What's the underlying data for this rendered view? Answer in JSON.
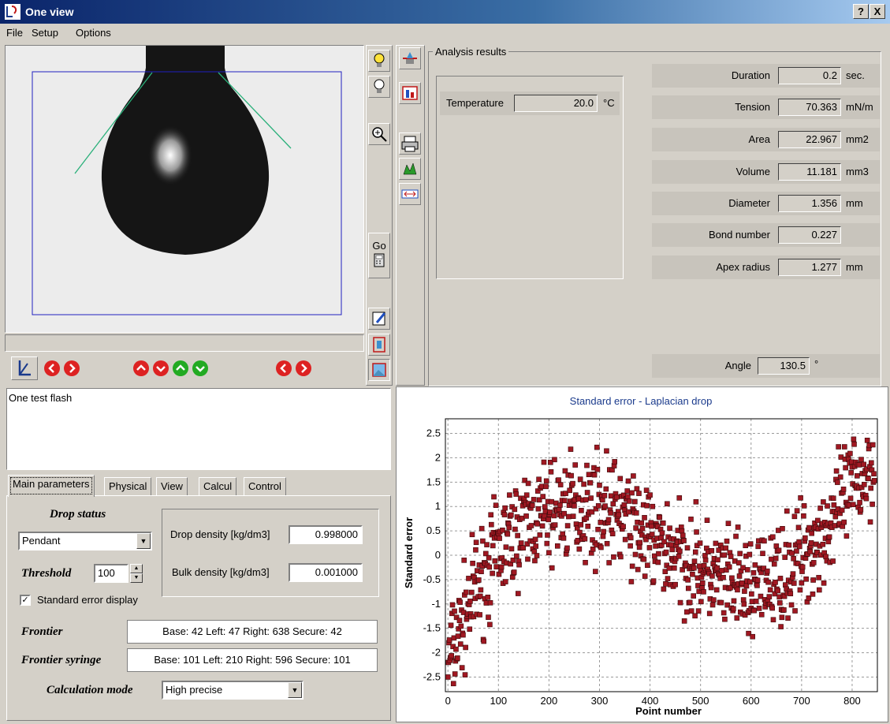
{
  "window": {
    "title": "One view",
    "help_label": "?",
    "close_label": "X"
  },
  "menu": [
    "File",
    "Setup",
    "Options"
  ],
  "analysis": {
    "group_title": "Analysis results",
    "temperature": {
      "label": "Temperature",
      "value": "20.0",
      "unit": "°C"
    },
    "results": [
      {
        "label": "Duration",
        "value": "0.2",
        "unit": "sec."
      },
      {
        "label": "Tension",
        "value": "70.363",
        "unit": "mN/m"
      },
      {
        "label": "Area",
        "value": "22.967",
        "unit": "mm2"
      },
      {
        "label": "Volume",
        "value": "11.181",
        "unit": "mm3"
      },
      {
        "label": "Diameter",
        "value": "1.356",
        "unit": "mm"
      },
      {
        "label": "Bond number",
        "value": "0.227",
        "unit": ""
      },
      {
        "label": "Apex radius",
        "value": "1.277",
        "unit": "mm"
      }
    ],
    "angle": {
      "label": "Angle",
      "value": "130.5",
      "unit": "°"
    }
  },
  "toolbar": {
    "go_label": "Go"
  },
  "log": {
    "text": "One test flash"
  },
  "tabs": [
    "Main parameters",
    "Physical",
    "View",
    "Calcul",
    "Control"
  ],
  "main_params": {
    "drop_status_label": "Drop status",
    "drop_status_value": "Pendant",
    "threshold_label": "Threshold",
    "threshold_value": "100",
    "std_error_display_label": "Standard error display",
    "drop_density_label": "Drop density [kg/dm3]",
    "drop_density_value": "0.998000",
    "bulk_density_label": "Bulk density [kg/dm3]",
    "bulk_density_value": "0.001000",
    "frontier_label": "Frontier",
    "frontier_value": "Base: 42   Left: 47   Right: 638  Secure: 42",
    "frontier_syringe_label": "Frontier syringe",
    "frontier_syringe_value": "Base: 101  Left: 210  Right: 596  Secure: 101",
    "calc_mode_label": "Calculation mode",
    "calc_mode_value": "High precise"
  },
  "colors": {
    "marker": "#a01822",
    "title_text": "#1a3a8c",
    "frame_line": "#2020c0",
    "tangent": "#2ab07a"
  },
  "chart_data": {
    "type": "scatter",
    "title": "Standard error - Laplacian drop",
    "xlabel": "Point number",
    "ylabel": "Standard error",
    "xlim": [
      -5,
      850
    ],
    "ylim": [
      -2.8,
      2.8
    ],
    "xticks": [
      0,
      100,
      200,
      300,
      400,
      500,
      600,
      700,
      800
    ],
    "yticks": [
      -2.5,
      -2,
      -1.5,
      -1,
      -0.5,
      0,
      0.5,
      1,
      1.5,
      2,
      2.5
    ],
    "grid": true,
    "marker": "square",
    "trend": [
      [
        0,
        -2.2
      ],
      [
        50,
        -0.8
      ],
      [
        100,
        0.1
      ],
      [
        150,
        0.6
      ],
      [
        200,
        0.9
      ],
      [
        250,
        1.0
      ],
      [
        300,
        1.0
      ],
      [
        350,
        0.8
      ],
      [
        400,
        0.3
      ],
      [
        450,
        0.0
      ],
      [
        500,
        -0.3
      ],
      [
        550,
        -0.6
      ],
      [
        600,
        -0.7
      ],
      [
        650,
        -0.5
      ],
      [
        700,
        0.0
      ],
      [
        750,
        0.5
      ],
      [
        800,
        1.4
      ],
      [
        845,
        1.9
      ]
    ],
    "spread": 0.9,
    "point_count": 845
  }
}
